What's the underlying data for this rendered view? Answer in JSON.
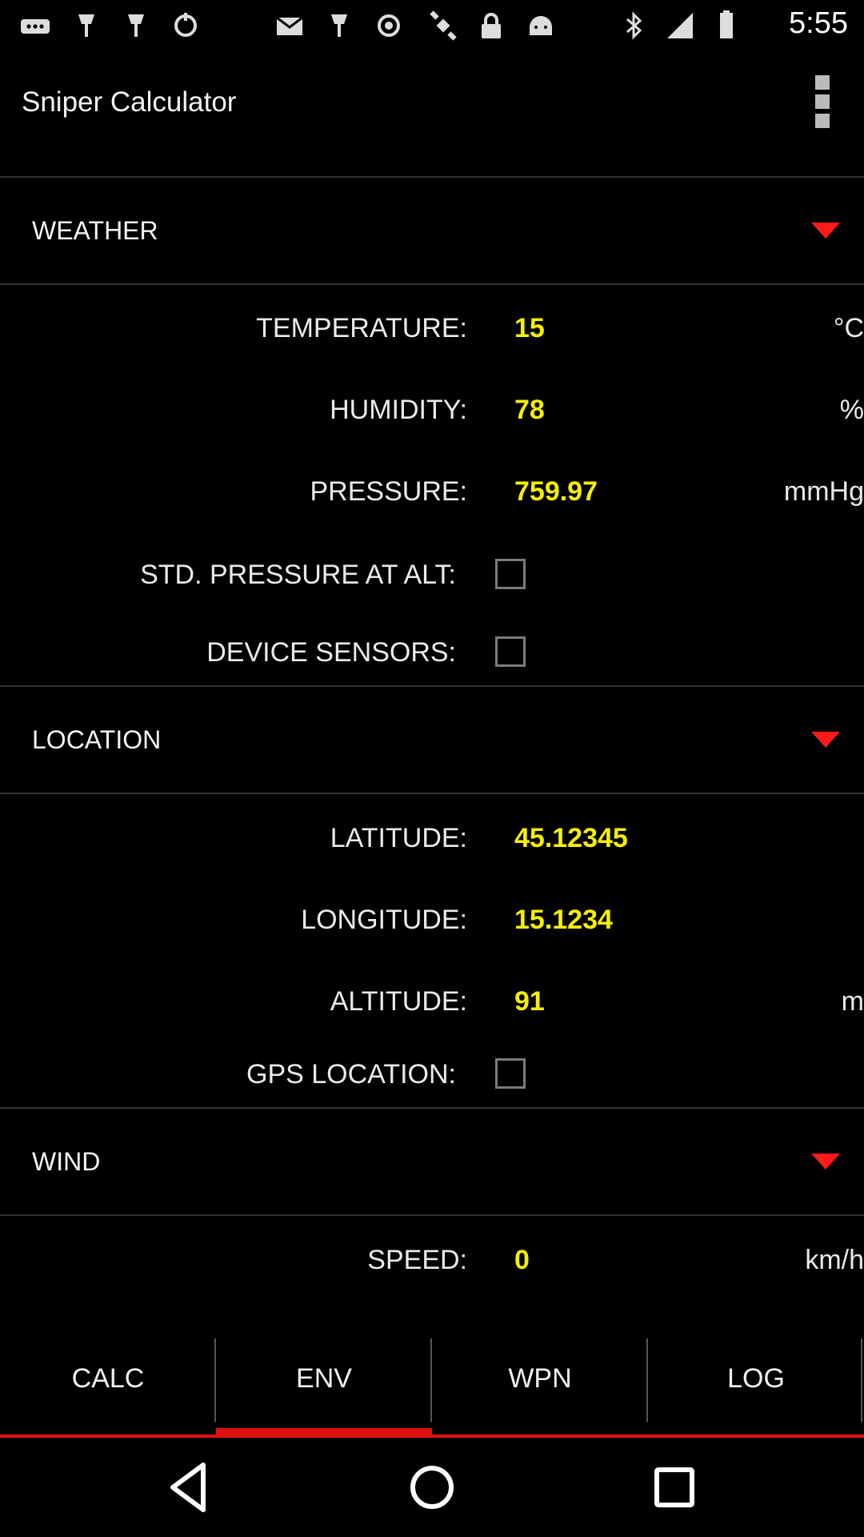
{
  "status_bar": {
    "time": "5:55",
    "icons": [
      "more-notifications-icon",
      "app-icon",
      "app-icon",
      "sync-icon",
      "email-icon",
      "app-icon",
      "fake-gps-icon",
      "lock-icon",
      "android-icon",
      "bluetooth-icon",
      "signal-icon",
      "battery-icon"
    ]
  },
  "app_bar": {
    "title": "Sniper Calculator",
    "menu_icon": "overflow-menu-icon"
  },
  "sections": {
    "weather": {
      "title": "WEATHER",
      "temperature": {
        "label": "TEMPERATURE:",
        "value": "15",
        "unit": "°C"
      },
      "humidity": {
        "label": "HUMIDITY:",
        "value": "78",
        "unit": "%"
      },
      "pressure": {
        "label": "PRESSURE:",
        "value": "759.97",
        "unit": "mmHg"
      },
      "std_pressure": {
        "label": "STD. PRESSURE AT ALT:",
        "checked": false
      },
      "device_sensors": {
        "label": "DEVICE SENSORS:",
        "checked": false
      }
    },
    "location": {
      "title": "LOCATION",
      "latitude": {
        "label": "LATITUDE:",
        "value": "45.12345"
      },
      "longitude": {
        "label": "LONGITUDE:",
        "value": "15.1234"
      },
      "altitude": {
        "label": "ALTITUDE:",
        "value": "91",
        "unit": "m"
      },
      "gps": {
        "label": "GPS LOCATION:",
        "checked": false
      }
    },
    "wind": {
      "title": "WIND",
      "speed": {
        "label": "SPEED:",
        "value": "0",
        "unit": "km/h"
      }
    }
  },
  "tabs": [
    {
      "label": "CALC",
      "selected": false
    },
    {
      "label": "ENV",
      "selected": true
    },
    {
      "label": "WPN",
      "selected": false
    },
    {
      "label": "LOG",
      "selected": false
    }
  ],
  "colors": {
    "accent": "#e01010",
    "value": "#f6f000",
    "background": "#000000"
  }
}
